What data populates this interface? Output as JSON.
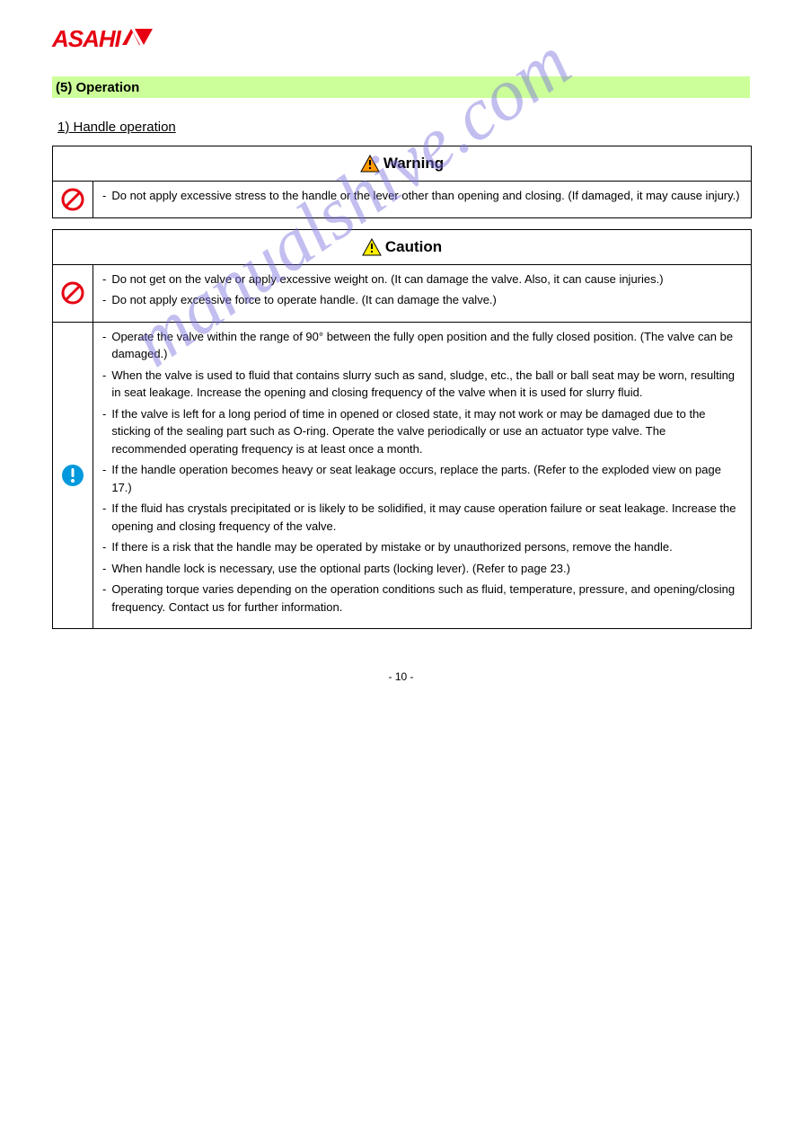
{
  "logo": {
    "text": "ASAHI"
  },
  "header_bar": "(5) Operation",
  "section_title": "1) Handle operation",
  "watermark": "manualshive.com",
  "page_number": "- 10 -",
  "warning_box": {
    "header": "Warning",
    "rows": [
      {
        "icon": "prohibit",
        "items": [
          {
            "bullet": "-",
            "text": "Do not apply excessive stress to the handle or the lever other than opening and closing. (If damaged, it may cause injury.)"
          }
        ]
      }
    ]
  },
  "caution_box": {
    "header": "Caution",
    "rows": [
      {
        "icon": "prohibit",
        "items": [
          {
            "bullet": "-",
            "text": "Do not get on the valve or apply excessive weight on. (It can damage the valve. Also, it can cause injuries.)"
          },
          {
            "bullet": "-",
            "text": "Do not apply excessive force to operate handle. (It can damage the valve.)"
          }
        ]
      },
      {
        "icon": "mandatory",
        "items": [
          {
            "bullet": "-",
            "text": "Operate the valve within the range of 90° between the fully open position and the fully closed position. (The valve can be damaged.)"
          },
          {
            "bullet": "-",
            "text": "When the valve is used to fluid that contains slurry such as sand, sludge, etc., the ball or ball seat may be worn, resulting in seat leakage. Increase the opening and closing frequency of the valve when it is used for slurry fluid."
          },
          {
            "bullet": "-",
            "text": "If the valve is left for a long period of time in opened or closed state, it may not work or may be damaged due to the sticking of the sealing part such as O-ring. Operate the valve periodically or use an actuator type valve. The recommended operating frequency is at least once a month."
          },
          {
            "bullet": "-",
            "text": "If the handle operation becomes heavy or seat leakage occurs, replace the parts. (Refer to the exploded view on page 17.)"
          },
          {
            "bullet": "-",
            "text": "If the fluid has crystals precipitated or is likely to be solidified, it may cause operation failure or seat leakage. Increase the opening and closing frequency of the valve."
          },
          {
            "bullet": "-",
            "text": "If there is a risk that the handle may be operated by mistake or by unauthorized persons, remove the handle."
          },
          {
            "bullet": "-",
            "text": "When handle lock is necessary, use the optional parts (locking lever). (Refer to page 23.)"
          },
          {
            "bullet": "-",
            "text": "Operating torque varies depending on the operation conditions such as fluid, temperature, pressure, and opening/closing frequency. Contact us for further information."
          }
        ]
      }
    ]
  }
}
